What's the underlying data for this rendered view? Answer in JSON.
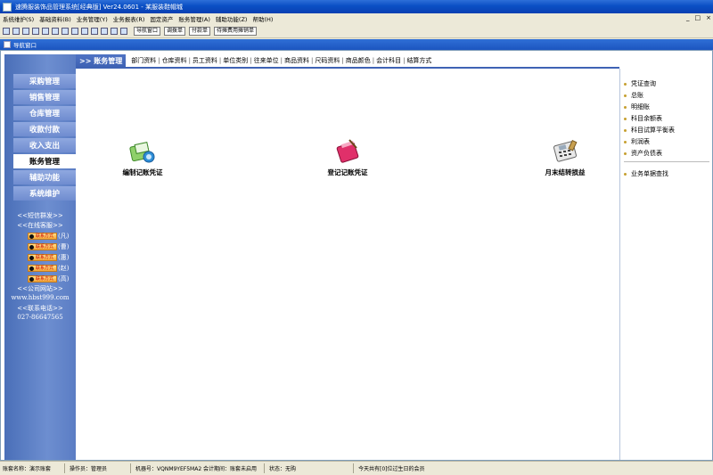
{
  "window": {
    "title": "速腾服装饰品管理系统[经典版] Ver24.0601 - 某服装鞋帽城",
    "menubar_right": [
      "_",
      "□",
      "×"
    ]
  },
  "menu": [
    "系统维护(S)",
    "基础资料(B)",
    "业务管理(Y)",
    "业务报表(R)",
    "固定资产",
    "账务管理(A)",
    "辅助功能(Z)",
    "帮助(H)"
  ],
  "toolbar": {
    "buttons": [
      "导航窗口",
      "调拨单",
      "付款单",
      "待摊费用摊销单"
    ]
  },
  "nav_window": {
    "title": "导航窗口"
  },
  "sidebar": {
    "items": [
      "采购管理",
      "销售管理",
      "仓库管理",
      "收款付款",
      "收入支出",
      "账务管理",
      "辅助功能",
      "系统维护"
    ],
    "active_index": 5,
    "sms": "<<短信群发>>",
    "online": "<<在线客服>>",
    "qq_badge": "联系方式",
    "qq_names": [
      "(凡)",
      "(曹)",
      "(惠)",
      "(赵)",
      "(高)"
    ],
    "website_title": "<<公司网站>>",
    "website": "www.hbst999.com",
    "phone_title": "<<联系电话>>",
    "phone": "027-86647565"
  },
  "tabs": {
    "active": ">> 账务管理",
    "links": [
      "部门资料",
      "仓库资料",
      "员工资料",
      "单位类别",
      "往来单位",
      "商品资料",
      "尺码资料",
      "商品颜色",
      "会计科目",
      "结算方式"
    ]
  },
  "actions": [
    {
      "label": "编制记账凭证",
      "icon": "edit-voucher-icon"
    },
    {
      "label": "登记记账凭证",
      "icon": "register-voucher-icon"
    },
    {
      "label": "月末结转损益",
      "icon": "month-end-transfer-icon"
    }
  ],
  "right_links": {
    "group1": [
      "凭证查询",
      "总账",
      "明细账",
      "科目余额表",
      "科目试算平衡表",
      "利润表",
      "资产负债表"
    ],
    "group2": [
      "业务单据查找"
    ]
  },
  "status": {
    "account": "账套名称：演示账套",
    "operator": "操作员：管理员",
    "machine": "机器号：VQNM9YEF5MA2 会计期间：账套未启用",
    "state": "状态：无购",
    "birthday": "今天共有[0]位过生日的会员"
  },
  "colors": {
    "accent": "#3e62b4",
    "sidebar": "#5b7dc4",
    "titlebar": "#0a4fc4"
  }
}
